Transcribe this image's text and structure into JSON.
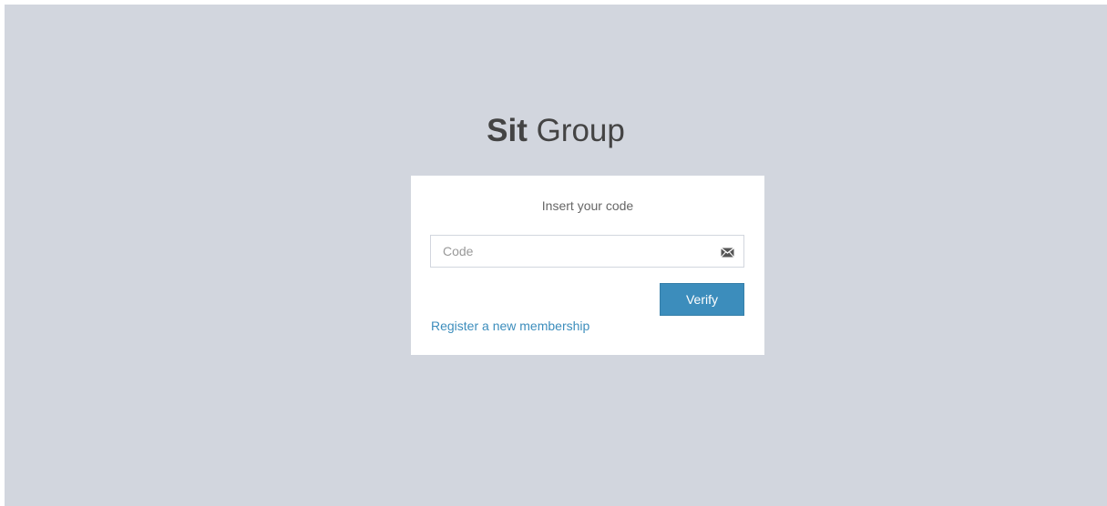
{
  "logo": {
    "bold": "Sit",
    "light": " Group"
  },
  "login_box": {
    "message": "Insert your code",
    "code_input": {
      "placeholder": "Code",
      "value": "",
      "icon": "envelope-icon"
    },
    "verify_label": "Verify",
    "register_link": "Register a new membership"
  },
  "colors": {
    "background": "#d2d6de",
    "box": "#ffffff",
    "accent": "#3c8dbc",
    "logo_text": "#444444"
  }
}
